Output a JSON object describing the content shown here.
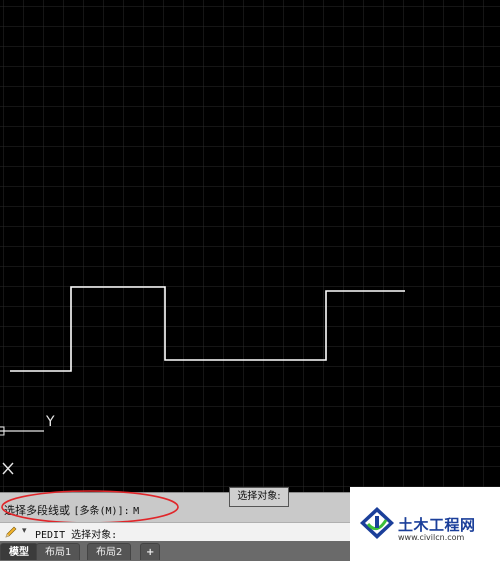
{
  "command_history": {
    "prompt_label": "选择多段线或",
    "option_text": "[多条(M)]:",
    "typed_value": "M"
  },
  "command_input": {
    "prompt": "PEDIT 选择对象:"
  },
  "tooltip": {
    "text": "选择对象:"
  },
  "ucs": {
    "y_label": "Y"
  },
  "tabs": [
    {
      "label": "模型"
    },
    {
      "label": "布局1"
    },
    {
      "label": "布局2"
    },
    {
      "label": "+"
    }
  ],
  "watermark": {
    "name": "土木工程网",
    "url": "www.civilcn.com"
  },
  "colors": {
    "canvas_background": "#000000",
    "grid": "#2a2a2a",
    "polyline": "#ffffff",
    "annotation_circle": "#e0262a",
    "logo_blue": "#1b3f9a"
  },
  "icons": [
    "pencil-icon",
    "dropdown-caret-icon",
    "ucs-icon",
    "close-icon"
  ]
}
